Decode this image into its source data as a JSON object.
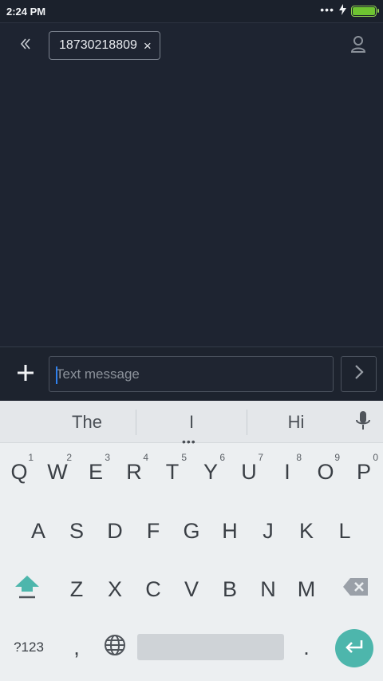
{
  "status_bar": {
    "time": "2:24 PM",
    "dots": "•••",
    "battery_level": 1.0,
    "battery_color": "#6ec431"
  },
  "header": {
    "recipient": "18730218809",
    "back_icon": "double-chevron-left-icon",
    "contact_icon": "person-icon",
    "remove_icon": "close-icon"
  },
  "compose": {
    "placeholder": "Text message",
    "value": "",
    "add_icon": "plus-icon",
    "send_icon": "chevron-right-icon"
  },
  "keyboard": {
    "suggestions": [
      "The",
      "I",
      "Hi"
    ],
    "more_indicator": "•••",
    "row1": [
      {
        "label": "Q",
        "hint": "1"
      },
      {
        "label": "W",
        "hint": "2"
      },
      {
        "label": "E",
        "hint": "3"
      },
      {
        "label": "R",
        "hint": "4"
      },
      {
        "label": "T",
        "hint": "5"
      },
      {
        "label": "Y",
        "hint": "6"
      },
      {
        "label": "U",
        "hint": "7"
      },
      {
        "label": "I",
        "hint": "8"
      },
      {
        "label": "O",
        "hint": "9"
      },
      {
        "label": "P",
        "hint": "0"
      }
    ],
    "row2": [
      "A",
      "S",
      "D",
      "F",
      "G",
      "H",
      "J",
      "K",
      "L"
    ],
    "row3": [
      "Z",
      "X",
      "C",
      "V",
      "B",
      "N",
      "M"
    ],
    "symbols_label": "?123",
    "comma_label": ",",
    "period_label": ".",
    "accent_color": "#4db6ac"
  }
}
